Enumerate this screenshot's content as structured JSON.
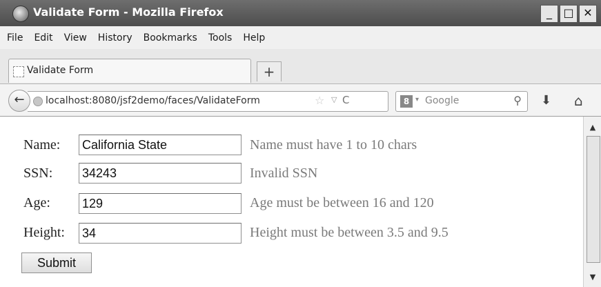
{
  "window": {
    "title": "Validate Form - Mozilla Firefox",
    "minimize_glyph": "_",
    "maximize_glyph": "□",
    "close_glyph": "✕"
  },
  "menu": [
    "File",
    "Edit",
    "View",
    "History",
    "Bookmarks",
    "Tools",
    "Help"
  ],
  "tab": {
    "title": "Validate Form",
    "new_tab_glyph": "+"
  },
  "nav": {
    "back_glyph": "←",
    "url": "localhost:8080/jsf2demo/faces/ValidateForm",
    "bookmark_glyph": "☆",
    "dropdown_glyph": "▽",
    "reload_glyph": "C",
    "search_engine_glyph": "8",
    "search_drop_glyph": "▾",
    "search_placeholder": "Google",
    "search_glyph": "⚲",
    "download_glyph": "⬇",
    "home_glyph": "⌂"
  },
  "form": {
    "fields": [
      {
        "label": "Name:",
        "value": "California State",
        "message": "Name must have 1 to 10 chars"
      },
      {
        "label": "SSN:",
        "value": "34243",
        "message": "Invalid SSN"
      },
      {
        "label": "Age:",
        "value": "129",
        "message": "Age must be between 16 and 120"
      },
      {
        "label": "Height:",
        "value": "34",
        "message": "Height must be between 3.5 and 9.5"
      }
    ],
    "submit_label": "Submit"
  },
  "scrollbar": {
    "up_glyph": "▲",
    "down_glyph": "▼"
  },
  "colors": {
    "titlebar": "#4d4d4d",
    "message_text": "#7a7a7a"
  }
}
